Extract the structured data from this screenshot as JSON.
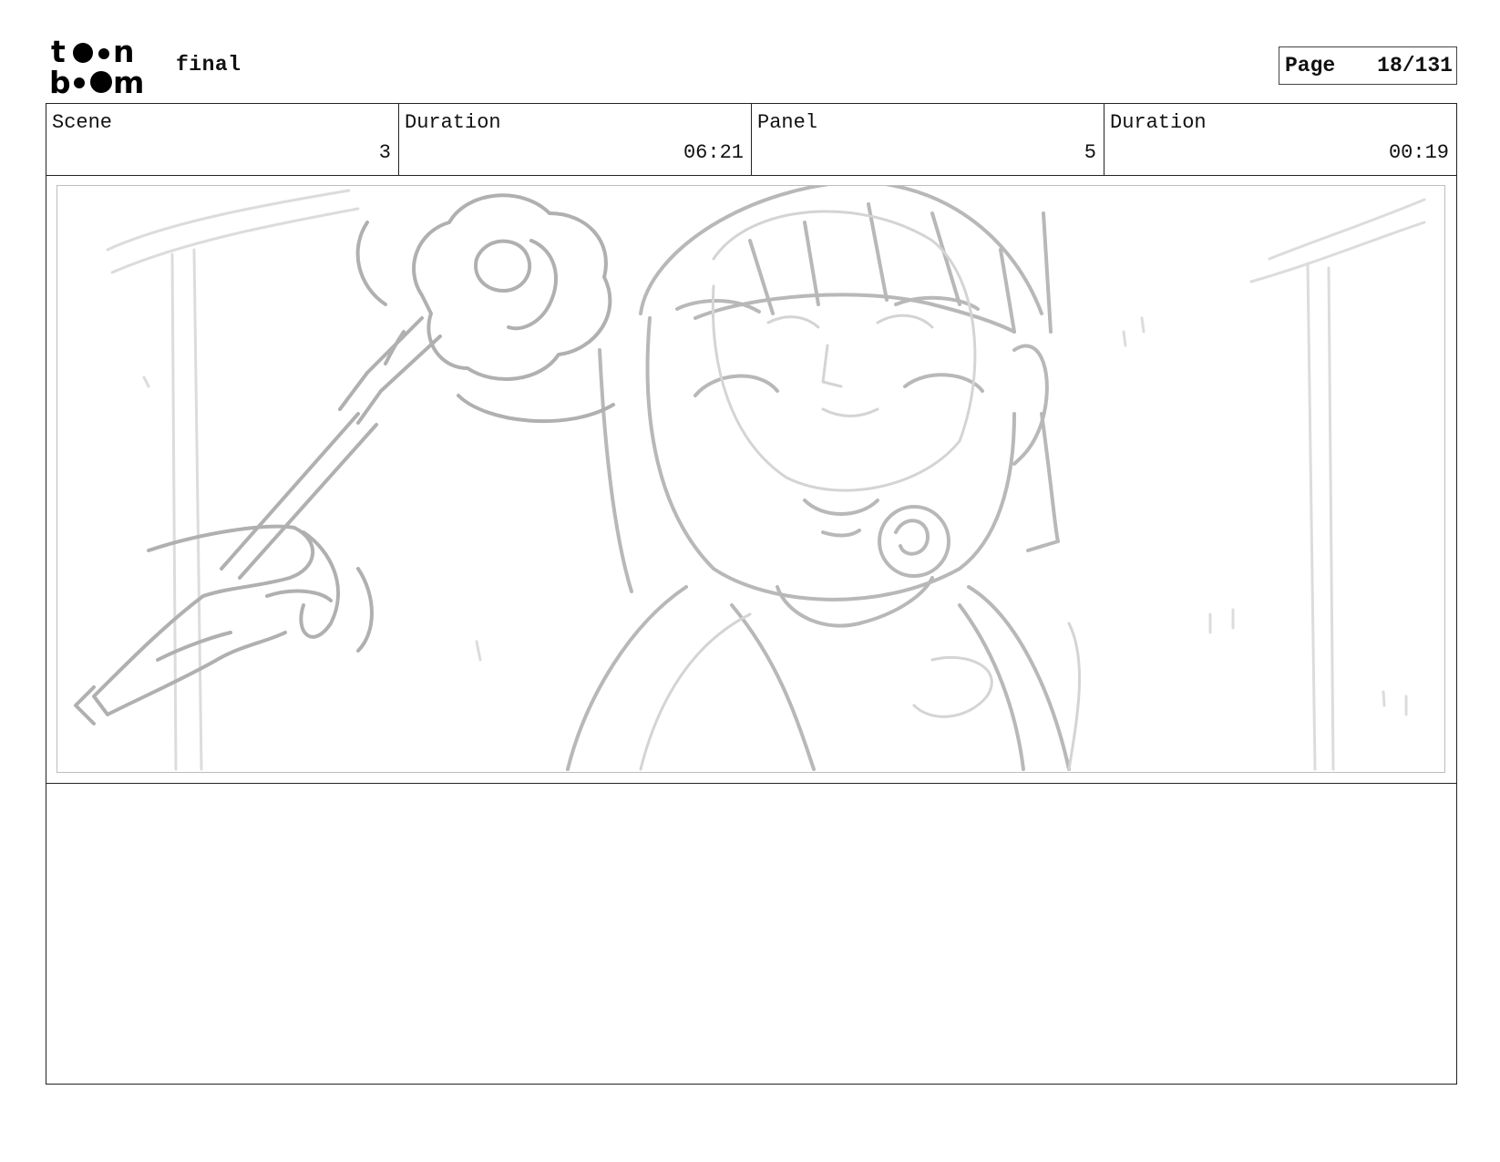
{
  "header": {
    "logo_text": "toon boom",
    "project_title": "final",
    "page_label": "Page",
    "page_value": "18/131"
  },
  "info": {
    "scene_label": "Scene",
    "scene_value": "3",
    "scene_duration_label": "Duration",
    "scene_duration_value": "06:21",
    "panel_label": "Panel",
    "panel_value": "5",
    "panel_duration_label": "Duration",
    "panel_duration_value": "00:19"
  },
  "panel": {
    "sketch_stroke_color": "#b0b0b0",
    "background_stroke_color": "#d8d8d8"
  },
  "caption": {
    "text": ""
  }
}
